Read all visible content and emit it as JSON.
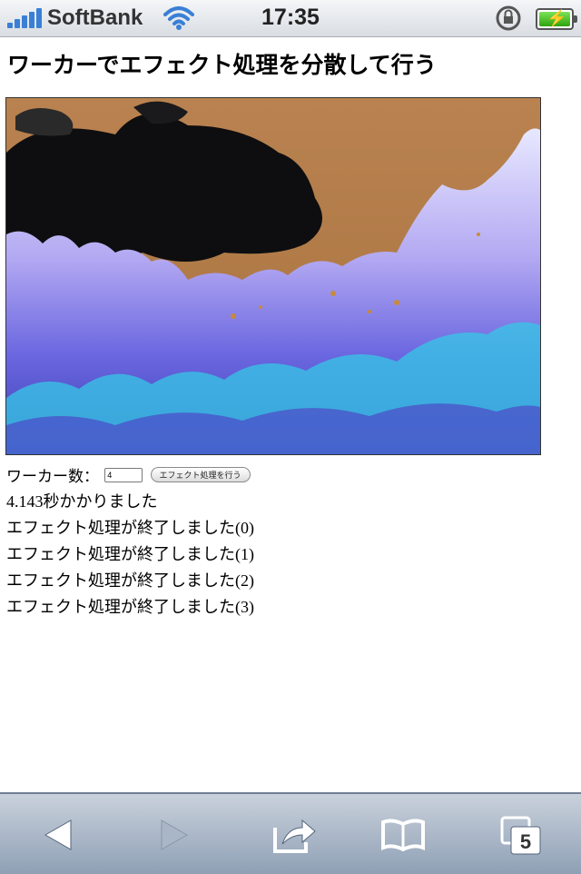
{
  "status_bar": {
    "carrier": "SoftBank",
    "time": "17:35",
    "accent_color": "#3a7fd6"
  },
  "page": {
    "title": "ワーカーでエフェクト処理を分散して行う"
  },
  "image": {
    "description_icon": "inverted-forest-photo"
  },
  "controls": {
    "worker_label": "ワーカー数：",
    "worker_count_value": "4",
    "run_button_label": "エフェクト処理を行う"
  },
  "log": {
    "elapsed": "4.143秒かかりました",
    "messages": [
      "エフェクト処理が終了しました(0)",
      "エフェクト処理が終了しました(1)",
      "エフェクト処理が終了しました(2)",
      "エフェクト処理が終了しました(3)"
    ]
  },
  "toolbar": {
    "tabs_count": "5",
    "icons": [
      "back-icon",
      "forward-icon",
      "share-icon",
      "bookmarks-icon",
      "tabs-icon"
    ]
  }
}
